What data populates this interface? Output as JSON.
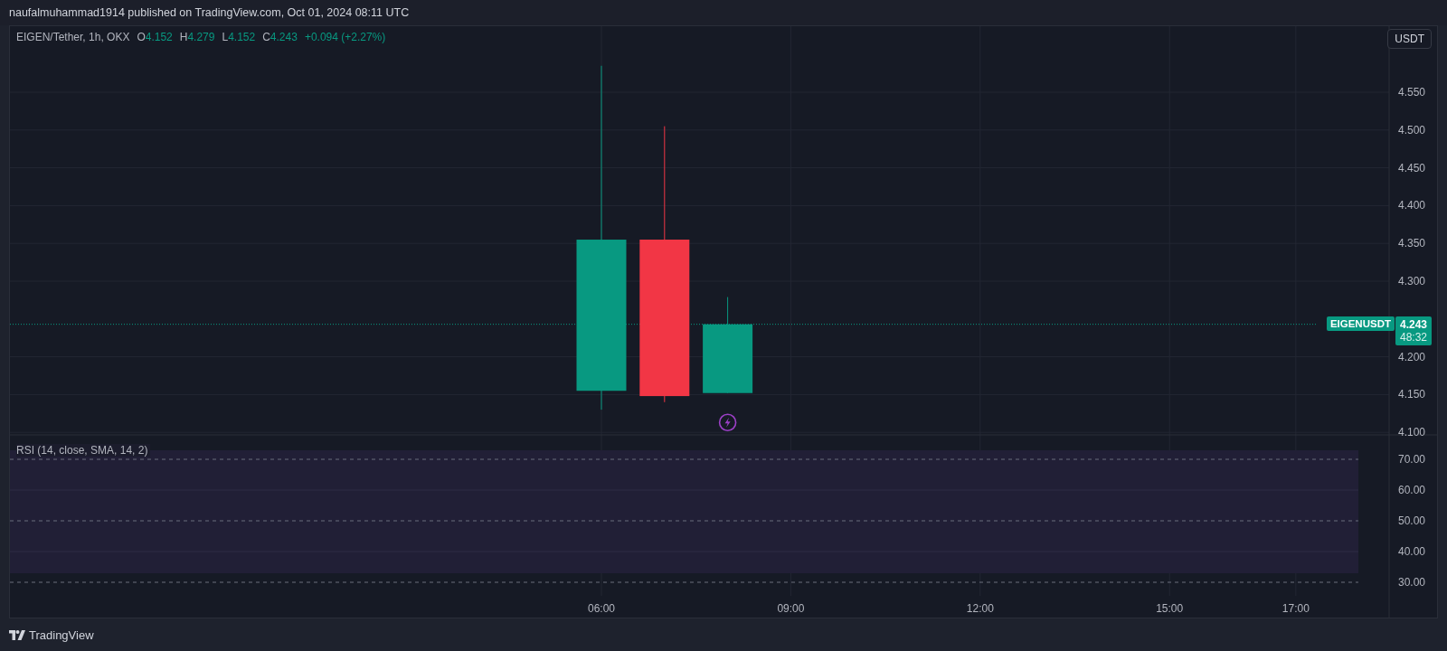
{
  "header": {
    "text": "naufalmuhammad1914 published on TradingView.com, Oct 01, 2024 08:11 UTC"
  },
  "legend": {
    "symbol": "EIGEN/Tether, 1h, OKX",
    "ohlc": [
      {
        "key": "O",
        "value": "4.152"
      },
      {
        "key": "H",
        "value": "4.279"
      },
      {
        "key": "L",
        "value": "4.152"
      },
      {
        "key": "C",
        "value": "4.243"
      }
    ],
    "change": "+0.094 (+2.27%)"
  },
  "currency_button": {
    "label": "USDT"
  },
  "candles": [
    {
      "kind": "up"
    },
    {
      "kind": "down"
    },
    {
      "kind": "up"
    }
  ],
  "price_axis": [
    "4.550",
    "4.500",
    "4.450",
    "4.400",
    "4.350",
    "4.300",
    "4.200",
    "4.150",
    "4.100"
  ],
  "time_axis": [
    "06:00",
    "09:00",
    "12:00",
    "15:00",
    "17:00"
  ],
  "price_label": {
    "symbol": "EIGENUSDT",
    "price": "4.243",
    "countdown": "48:32"
  },
  "rsi": {
    "label": "RSI (14, close, SMA, 14, 2)",
    "axis_labels": [
      "70.00",
      "60.00",
      "50.00",
      "40.00",
      "30.00"
    ]
  },
  "footer": {
    "brand": "TradingView"
  }
}
